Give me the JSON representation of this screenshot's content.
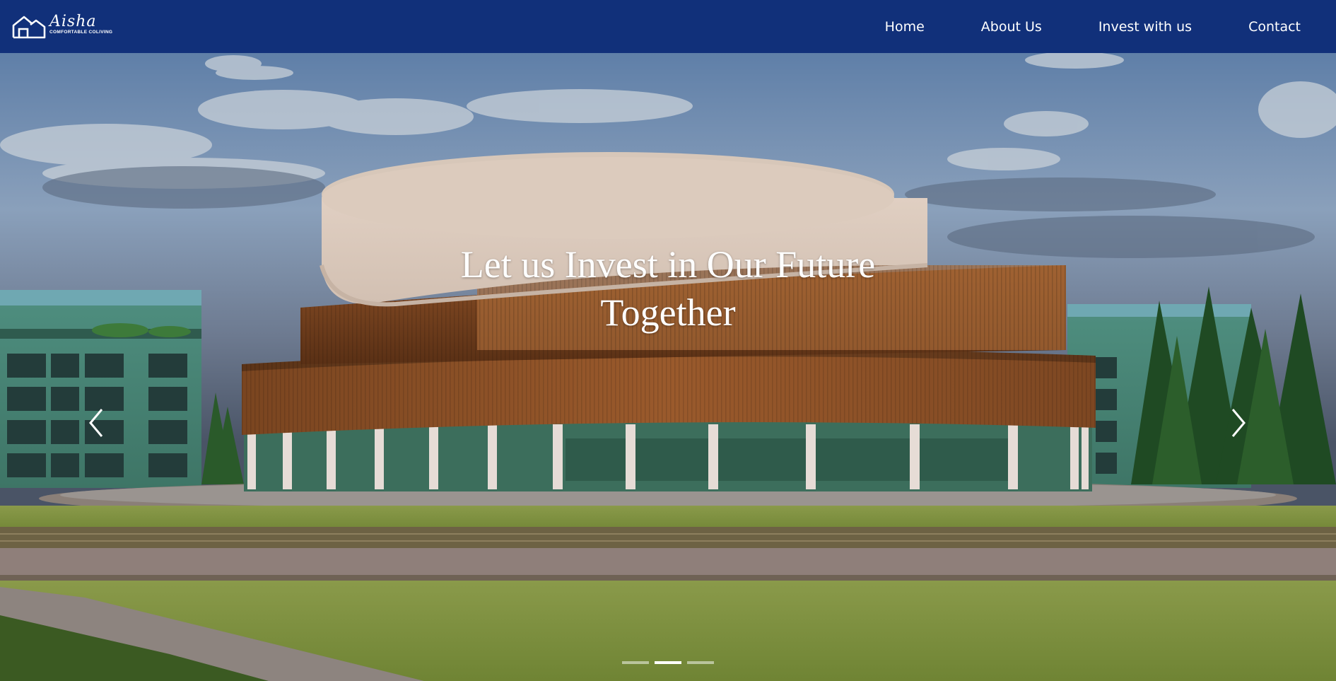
{
  "brand": {
    "script_name": "Aisha",
    "tagline": "COMFORTABLE COLIVING"
  },
  "nav": {
    "items": [
      {
        "label": "Home"
      },
      {
        "label": "About Us"
      },
      {
        "label": "Invest with us"
      },
      {
        "label": "Contact"
      }
    ]
  },
  "hero": {
    "caption_line1": "Let us Invest in Our Future",
    "caption_line2": "Together",
    "slides_total": 3,
    "active_slide": 2,
    "prev_icon": "chevron-left-icon",
    "next_icon": "chevron-right-icon"
  },
  "colors": {
    "navbar": "#11307a",
    "text": "#ffffff"
  }
}
